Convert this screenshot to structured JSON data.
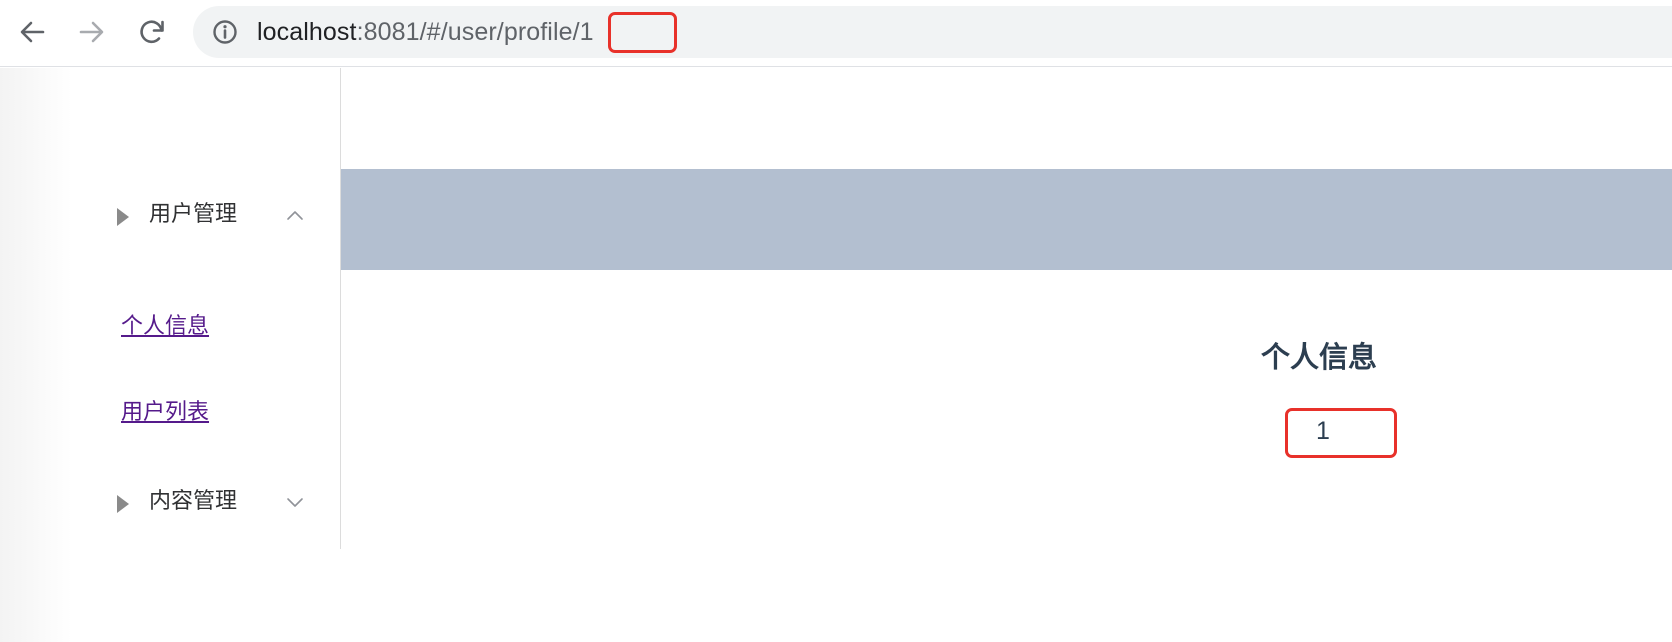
{
  "browser": {
    "url_host": "localhost",
    "url_rest": ":8081/#/user/profile/1",
    "icons": [
      "back-arrow-icon",
      "forward-arrow-icon",
      "reload-icon",
      "info-icon"
    ]
  },
  "sidebar": {
    "groups": [
      {
        "label": "用户管理",
        "expanded": true,
        "chevron": "chevron-up-icon"
      },
      {
        "label": "内容管理",
        "expanded": false,
        "chevron": "chevron-down-icon"
      }
    ],
    "links": [
      {
        "label": "个人信息"
      },
      {
        "label": "用户列表"
      }
    ]
  },
  "main": {
    "title": "个人信息",
    "user_id": "1"
  },
  "colors": {
    "header_band": "#b3bfd0",
    "highlight": "#e8312a",
    "visited_link": "#551a8b",
    "title_text": "#2c3e50"
  }
}
